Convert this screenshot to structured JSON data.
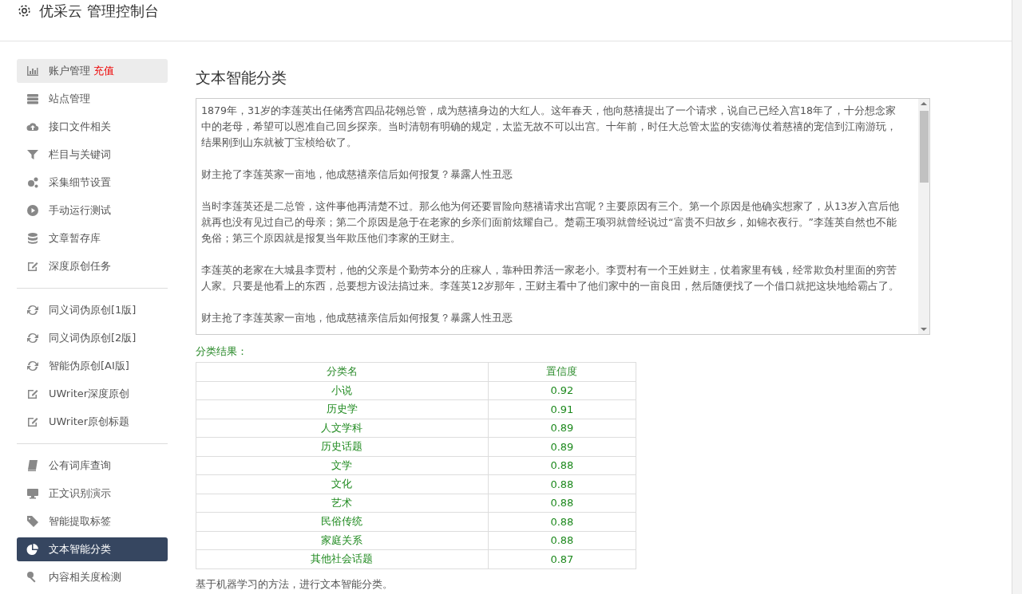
{
  "header": {
    "title": "优采云 管理控制台"
  },
  "sidebar": {
    "groups": [
      {
        "items": [
          {
            "label": "账户管理",
            "badge": "充值",
            "hovered": true,
            "selected": false
          },
          {
            "label": "站点管理",
            "hovered": false,
            "selected": false
          },
          {
            "label": "接口文件相关",
            "hovered": false,
            "selected": false
          },
          {
            "label": "栏目与关键词",
            "hovered": false,
            "selected": false
          },
          {
            "label": "采集细节设置",
            "hovered": false,
            "selected": false
          },
          {
            "label": "手动运行测试",
            "hovered": false,
            "selected": false
          },
          {
            "label": "文章暂存库",
            "hovered": false,
            "selected": false
          },
          {
            "label": "深度原创任务",
            "hovered": false,
            "selected": false
          }
        ]
      },
      {
        "items": [
          {
            "label": "同义词伪原创[1版]",
            "hovered": false,
            "selected": false
          },
          {
            "label": "同义词伪原创[2版]",
            "hovered": false,
            "selected": false
          },
          {
            "label": "智能伪原创[AI版]",
            "hovered": false,
            "selected": false
          },
          {
            "label": "UWriter深度原创",
            "hovered": false,
            "selected": false
          },
          {
            "label": "UWriter原创标题",
            "hovered": false,
            "selected": false
          }
        ]
      },
      {
        "items": [
          {
            "label": "公有词库查询",
            "hovered": false,
            "selected": false
          },
          {
            "label": "正文识别演示",
            "hovered": false,
            "selected": false
          },
          {
            "label": "智能提取标签",
            "hovered": false,
            "selected": false
          },
          {
            "label": "文本智能分类",
            "hovered": false,
            "selected": true
          },
          {
            "label": "内容相关度检测",
            "hovered": false,
            "selected": false
          }
        ]
      }
    ]
  },
  "main": {
    "title": "文本智能分类",
    "text_input": {
      "paragraphs": [
        "1879年，31岁的李莲英出任储秀宫四品花翎总管，成为慈禧身边的大红人。这年春天，他向慈禧提出了一个请求，说自己已经入宫18年了，十分想念家中的老母，希望可以恩准自己回乡探亲。当时清朝有明确的规定，太监无故不可以出宫。十年前，时任大总管太监的安德海仗着慈禧的宠信到江南游玩，结果刚到山东就被丁宝桢给砍了。",
        "财主抢了李莲英家一亩地，他成慈禧亲信后如何报复？暴露人性丑恶",
        "当时李莲英还是二总管，这件事他再清楚不过。那么他为何还要冒险向慈禧请求出宫呢？主要原因有三个。第一个原因是他确实想家了，从13岁入宫后他就再也没有见过自己的母亲；第二个原因是急于在老家的乡亲们面前炫耀自己。楚霸王项羽就曾经说过“富贵不归故乡，如锦衣夜行。”李莲英自然也不能免俗；第三个原因就是报复当年欺压他们李家的王财主。",
        "李莲英的老家在大城县李贾村，他的父亲是个勤劳本分的庄稼人，靠种田养活一家老小。李贾村有一个王姓财主，仗着家里有钱，经常欺负村里面的穷苦人家。只要是他看上的东西，总要想方设法搞过来。李莲英12岁那年，王财主看中了他们家中的一亩良田，然后随便找了一个借口就把这块地给霸占了。",
        "财主抢了李莲英家一亩地，他成慈禧亲信后如何报复？暴露人性丑恶"
      ]
    },
    "results_label": "分类结果：",
    "table": {
      "columns": [
        "分类名",
        "置信度"
      ],
      "rows": [
        [
          "小说",
          "0.92"
        ],
        [
          "历史学",
          "0.91"
        ],
        [
          "人文学科",
          "0.89"
        ],
        [
          "历史话题",
          "0.89"
        ],
        [
          "文学",
          "0.88"
        ],
        [
          "文化",
          "0.88"
        ],
        [
          "艺术",
          "0.88"
        ],
        [
          "民俗传统",
          "0.88"
        ],
        [
          "家庭关系",
          "0.88"
        ],
        [
          "其他社会话题",
          "0.87"
        ]
      ]
    },
    "footnote": "基于机器学习的方法，进行文本智能分类。"
  }
}
